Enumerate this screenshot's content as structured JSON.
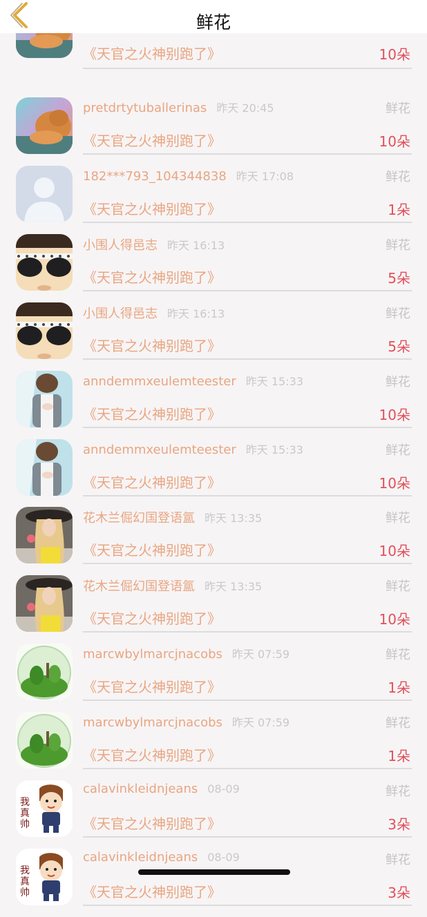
{
  "header": {
    "title": "鲜花"
  },
  "rows": [
    {
      "avatar": "cat-photo",
      "name": "",
      "time": "",
      "tag": "",
      "book": "《天官之火神别跑了》",
      "count": "10朵",
      "top_clip": true
    },
    {
      "avatar": "cat-photo",
      "name": "pretdrtytuballerinas",
      "time": "昨天 20:45",
      "tag": "鲜花",
      "book": "《天官之火神别跑了》",
      "count": "10朵"
    },
    {
      "avatar": "default-person",
      "name": "182***793_104344838",
      "time": "昨天 17:08",
      "tag": "鲜花",
      "book": "《天官之火神别跑了》",
      "count": "1朵"
    },
    {
      "avatar": "sunglasses-photo",
      "name": "小围人得邑志",
      "time": "昨天 16:13",
      "tag": "鲜花",
      "book": "《天官之火神别跑了》",
      "count": "5朵"
    },
    {
      "avatar": "sunglasses-photo",
      "name": "小围人得邑志",
      "time": "昨天 16:13",
      "tag": "鲜花",
      "book": "《天官之火神别跑了》",
      "count": "5朵"
    },
    {
      "avatar": "person-photo",
      "name": "anndemmxeulemteester",
      "time": "昨天 15:33",
      "tag": "鲜花",
      "book": "《天官之火神别跑了》",
      "count": "10朵"
    },
    {
      "avatar": "person-photo",
      "name": "anndemmxeulemteester",
      "time": "昨天 15:33",
      "tag": "鲜花",
      "book": "《天官之火神别跑了》",
      "count": "10朵"
    },
    {
      "avatar": "hat-woman-photo",
      "name": "花木兰倔幻国登语氲",
      "time": "昨天 13:35",
      "tag": "鲜花",
      "book": "《天官之火神别跑了》",
      "count": "10朵"
    },
    {
      "avatar": "hat-woman-photo",
      "name": "花木兰倔幻国登语氲",
      "time": "昨天 13:35",
      "tag": "鲜花",
      "book": "《天官之火神别跑了》",
      "count": "10朵"
    },
    {
      "avatar": "terrarium-photo",
      "name": "marcwbylmarcjnacobs",
      "time": "昨天 07:59",
      "tag": "鲜花",
      "book": "《天官之火神别跑了》",
      "count": "1朵"
    },
    {
      "avatar": "terrarium-photo",
      "name": "marcwbylmarcjnacobs",
      "time": "昨天 07:59",
      "tag": "鲜花",
      "book": "《天官之火神别跑了》",
      "count": "1朵"
    },
    {
      "avatar": "cartoon-boy",
      "name": "calavinkleidnjeans",
      "time": "08-09",
      "tag": "鲜花",
      "book": "《天官之火神别跑了》",
      "count": "3朵"
    },
    {
      "avatar": "cartoon-boy",
      "name": "calavinkleidnjeans",
      "time": "08-09",
      "tag": "鲜花",
      "book": "《天官之火神别跑了》",
      "count": "3朵"
    }
  ],
  "colors": {
    "name": "#e8a682",
    "count": "#e0505a",
    "meta": "#c9c9c9",
    "background": "#f7f4f5"
  }
}
